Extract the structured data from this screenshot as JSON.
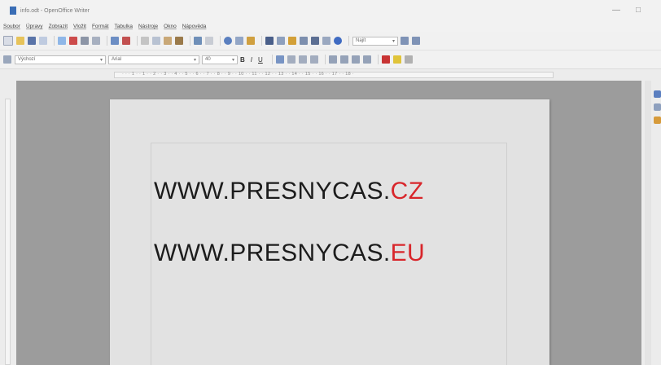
{
  "window": {
    "title": "info.odt - OpenOffice Writer",
    "minimize_glyph": "—",
    "maximize_glyph": "□"
  },
  "menu": [
    {
      "label": "Soubor"
    },
    {
      "label": "Úpravy"
    },
    {
      "label": "Zobrazit"
    },
    {
      "label": "Vložit"
    },
    {
      "label": "Formát"
    },
    {
      "label": "Tabulka"
    },
    {
      "label": "Nástroje"
    },
    {
      "label": "Okno"
    },
    {
      "label": "Nápověda"
    }
  ],
  "toolbar": {
    "find_placeholder": "Najít",
    "icons": [
      "new-icon",
      "open-icon",
      "save-icon",
      "email-icon",
      "edit-file-icon",
      "pdf-icon",
      "print-icon",
      "preview-icon",
      "spellcheck-icon",
      "autospell-icon",
      "cut-icon",
      "copy-icon",
      "paste-icon",
      "format-paint-icon",
      "undo-icon",
      "redo-icon",
      "hyperlink-icon",
      "table-icon",
      "draw-icon",
      "find-replace-icon",
      "navigator-icon",
      "gallery-icon",
      "datasource-icon",
      "nonprinting-icon",
      "zoom-icon",
      "help-icon"
    ]
  },
  "formatting": {
    "style": "Výchozí",
    "font": "Arial",
    "size": "40",
    "bold": "B",
    "italic": "I",
    "underline": "U"
  },
  "ruler": {
    "marks": "· · · 1 · · 1 · · 2 · · 3 · · 4 · · 5 · · 6 · · 7 · · 8 · · 9 · · 10 · · 11 · · 12 · · 13 · · 14 · · 15 · · 16 · · 17 · · 18 ·"
  },
  "document": {
    "line1": {
      "prefix": "WWW.PRESNYCAS.",
      "suffix": "CZ"
    },
    "line2": {
      "prefix": "WWW.PRESNYCAS.",
      "suffix": "EU"
    }
  },
  "colors": {
    "accent_red": "#d8262b",
    "text": "#1c1c1c",
    "workspace": "#9c9c9c",
    "page": "#e2e2e2"
  }
}
